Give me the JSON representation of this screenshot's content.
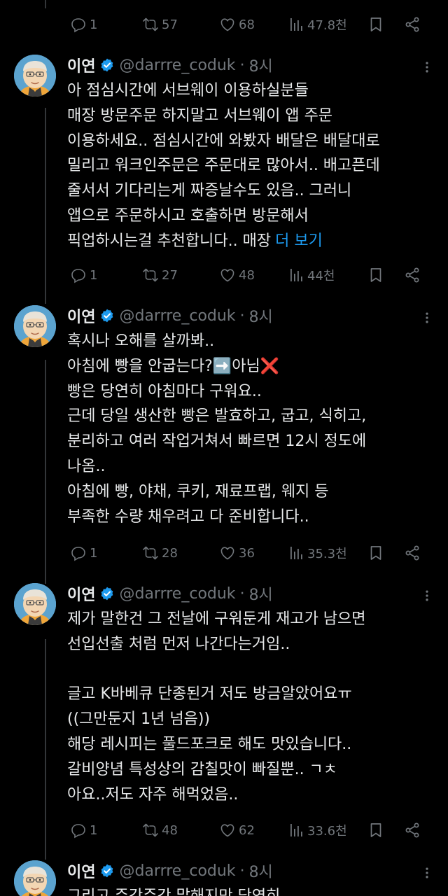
{
  "top_actions": {
    "replies": "1",
    "retweets": "57",
    "likes": "68",
    "views": "47.8천"
  },
  "tweets": [
    {
      "name": "이연",
      "handle": "@darrre_coduk",
      "sep": "·",
      "time": "8시",
      "lines": [
        "아 점심시간에 서브웨이 이용하실분들",
        "매장 방문주문 하지말고 서브웨이 앱 주문",
        "이용하세요.. 점심시간에 와봤자 배달은 배달대로",
        "밀리고 워크인주문은 주문대로 많아서.. 배고픈데",
        "줄서서 기다리는게 짜증날수도 있음.. 그러니",
        "앱으로 주문하시고 호출하면 방문해서",
        "픽업하시는걸 추천합니다.. 매장"
      ],
      "show_more": "더 보기",
      "actions": {
        "replies": "1",
        "retweets": "27",
        "likes": "48",
        "views": "44천"
      }
    },
    {
      "name": "이연",
      "handle": "@darrre_coduk",
      "sep": "·",
      "time": "8시",
      "lines": [
        "혹시나 오해를 살까봐..",
        "아침에 빵을 안굽는다?➡️아님❌",
        "빵은 당연히 아침마다 구워요..",
        "근데 당일 생산한 빵은 발효하고, 굽고, 식히고,",
        "분리하고 여러 작업거쳐서 빠르면 12시 정도에",
        "나옴..",
        "아침에 빵, 야채, 쿠키, 재료프랩, 웨지 등",
        "부족한 수량 채우려고 다 준비합니다.."
      ],
      "actions": {
        "replies": "1",
        "retweets": "28",
        "likes": "36",
        "views": "35.3천"
      }
    },
    {
      "name": "이연",
      "handle": "@darrre_coduk",
      "sep": "·",
      "time": "8시",
      "lines": [
        "제가 말한건 그 전날에 구워둔게 재고가 남으면",
        "선입선출 처럼 먼저 나간다는거임..",
        "",
        "글고 K바베큐 단종된거 저도 방금알았어요ㅠ",
        "((그만둔지 1년 넘음))",
        "해당 레시피는 풀드포크로 해도 맛있습니다..",
        "갈비양념 특성상의 감칠맛이 빠질뿐.. ㄱㅊ",
        "아요..저도 자주 해먹었음.."
      ],
      "actions": {
        "replies": "1",
        "retweets": "48",
        "likes": "62",
        "views": "33.6천"
      }
    },
    {
      "name": "이연",
      "handle": "@darrre_coduk",
      "sep": "·",
      "time": "8시",
      "lines": [
        "그리고 주간주간 말해지만 당연히"
      ]
    }
  ],
  "colors": {
    "accent": "#1d9bf0",
    "muted": "#71767b",
    "text": "#e7e9ea",
    "background": "#000000"
  },
  "icons": [
    "reply-icon",
    "retweet-icon",
    "like-icon",
    "views-icon",
    "bookmark-icon",
    "share-icon",
    "verified-icon",
    "more-icon"
  ]
}
